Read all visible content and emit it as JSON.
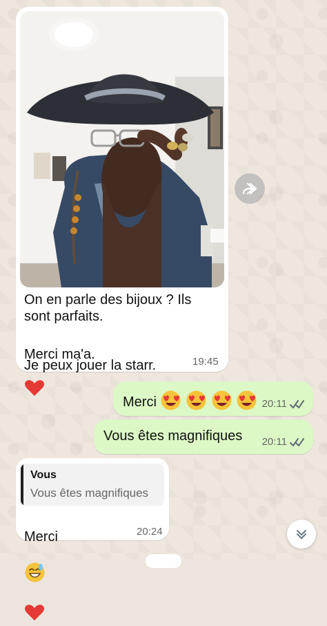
{
  "messages": {
    "incoming_photo": {
      "line1": "On en parle des bijoux ? Ils\nsont parfaits.",
      "line2": "Merci ma'a.",
      "line3": "Je peux jouer la starr.",
      "time": "19:45"
    },
    "outgoing_1": {
      "text": "Merci",
      "time": "20:11"
    },
    "outgoing_2": {
      "text": "Vous êtes magnifiques",
      "time": "20:11"
    },
    "incoming_reply": {
      "quoted_name": "Vous",
      "quoted_text": "Vous êtes magnifiques",
      "text": "Merci",
      "time": "20:24"
    }
  },
  "icons": {
    "forward": "forward-icon",
    "heart": "heart-icon",
    "heart_eyes": "heart-eyes-emoji-icon",
    "grin": "grinning-sweat-emoji-icon",
    "double_check": "double-check-icon",
    "scroll_down": "chevron-down-double-icon"
  },
  "colors": {
    "incoming_bubble": "#ffffff",
    "outgoing_bubble": "#dcf8c6",
    "heart": "#e53935",
    "check": "#5f6b73"
  }
}
